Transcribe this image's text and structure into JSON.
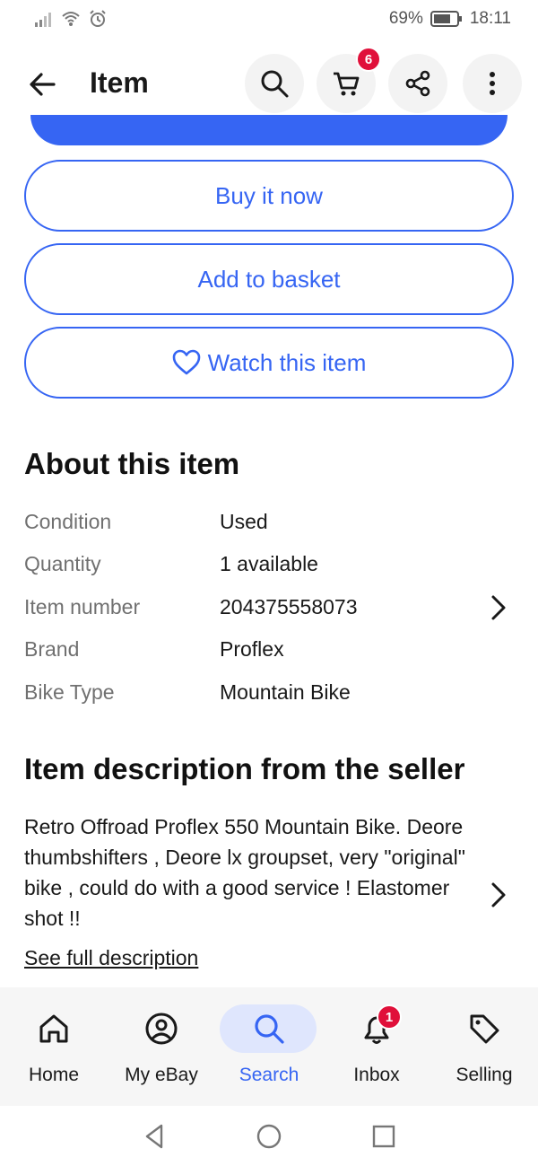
{
  "status": {
    "battery": "69%",
    "time": "18:11"
  },
  "appbar": {
    "title": "Item",
    "cart_count": "6"
  },
  "buttons": {
    "buy_now": "Buy it now",
    "add_to_basket": "Add to basket",
    "watch": "Watch this item"
  },
  "about": {
    "heading": "About this item",
    "rows": [
      {
        "key": "Condition",
        "value": "Used"
      },
      {
        "key": "Quantity",
        "value": "1 available"
      },
      {
        "key": "Item number",
        "value": "204375558073"
      },
      {
        "key": "Brand",
        "value": "Proflex"
      },
      {
        "key": "Bike Type",
        "value": "Mountain Bike"
      }
    ]
  },
  "description": {
    "heading": "Item description from the seller",
    "text": "Retro Offroad Proflex 550 Mountain Bike. Deore thumbshifters , Deore lx groupset, very \"original\" bike , could do with a good service ! Elastomer shot !!",
    "see_full": "See full description"
  },
  "bottom_nav": {
    "items": [
      {
        "label": "Home"
      },
      {
        "label": "My eBay"
      },
      {
        "label": "Search"
      },
      {
        "label": "Inbox",
        "badge": "1"
      },
      {
        "label": "Selling"
      }
    ]
  },
  "colors": {
    "accent": "#3665f3",
    "badge": "#e0103a"
  }
}
